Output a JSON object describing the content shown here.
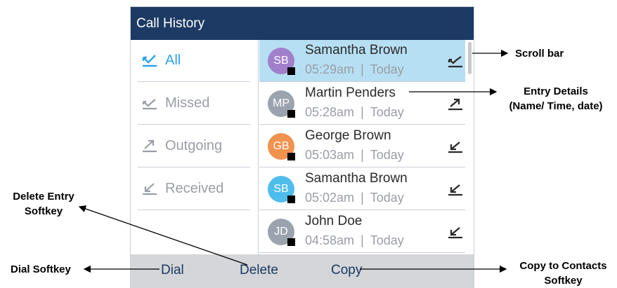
{
  "screen": {
    "title": "Call History",
    "filters": [
      {
        "label": "All",
        "icon": "all-calls-icon",
        "active": true
      },
      {
        "label": "Missed",
        "icon": "missed-call-icon",
        "active": false
      },
      {
        "label": "Outgoing",
        "icon": "outgoing-call-icon",
        "active": false
      },
      {
        "label": "Received",
        "icon": "received-call-icon",
        "active": false
      }
    ],
    "entries": [
      {
        "initials": "SB",
        "name": "Samantha Brown",
        "time": "05:29am",
        "date": "Today",
        "type": "missed",
        "avatar_color": "#a27fcb",
        "selected": true
      },
      {
        "initials": "MP",
        "name": "Martin Penders",
        "time": "05:28am",
        "date": "Today",
        "type": "outgoing",
        "avatar_color": "#9ba4ae",
        "selected": false
      },
      {
        "initials": "GB",
        "name": "George Brown",
        "time": "05:03am",
        "date": "Today",
        "type": "received",
        "avatar_color": "#f2924f",
        "selected": false
      },
      {
        "initials": "SB",
        "name": "Samantha Brown",
        "time": "05:02am",
        "date": "Today",
        "type": "received",
        "avatar_color": "#4fbdec",
        "selected": false
      },
      {
        "initials": "JD",
        "name": "John Doe",
        "time": "04:58am",
        "date": "Today",
        "type": "received",
        "avatar_color": "#9ba4ae",
        "selected": false
      }
    ],
    "date_separator": "|",
    "softkeys": {
      "dial": "Dial",
      "delete": "Delete",
      "copy": "Copy"
    }
  },
  "callouts": {
    "scroll_bar": "Scroll bar",
    "entry_details_line1": "Entry Details",
    "entry_details_line2": "(Name/ Time, date)",
    "delete_entry_line1": "Delete Entry",
    "delete_entry_line2": "Softkey",
    "dial_softkey": "Dial Softkey",
    "copy_contacts_line1": "Copy to Contacts",
    "copy_contacts_line2": "Softkey"
  },
  "colors": {
    "title_bar": "#1c3a63",
    "active_filter": "#2ea3e6",
    "selected_row": "#b7dff3",
    "softkey_bar": "#d4d6d9"
  }
}
